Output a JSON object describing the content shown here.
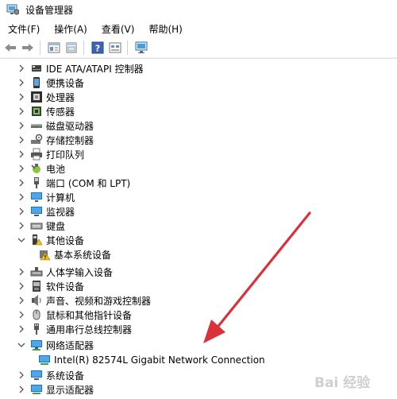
{
  "window": {
    "title": "设备管理器"
  },
  "menu": [
    {
      "label": "文件(F)"
    },
    {
      "label": "操作(A)"
    },
    {
      "label": "查看(V)"
    },
    {
      "label": "帮助(H)"
    }
  ],
  "toolbar": {
    "icons": [
      "back-arrow-icon",
      "forward-arrow-icon",
      "properties-icon",
      "update-driver-icon",
      "help-icon",
      "show-hidden-icon",
      "scan-hardware-icon"
    ]
  },
  "tree": {
    "items": [
      {
        "label": "IDE ATA/ATAPI 控制器",
        "icon": "ide-controller-icon",
        "expanded": false
      },
      {
        "label": "便携设备",
        "icon": "portable-device-icon",
        "expanded": false
      },
      {
        "label": "处理器",
        "icon": "processor-icon",
        "expanded": false
      },
      {
        "label": "传感器",
        "icon": "sensor-icon",
        "expanded": false
      },
      {
        "label": "磁盘驱动器",
        "icon": "disk-drive-icon",
        "expanded": false
      },
      {
        "label": "存储控制器",
        "icon": "storage-controller-icon",
        "expanded": false
      },
      {
        "label": "打印队列",
        "icon": "printer-icon",
        "expanded": false
      },
      {
        "label": "电池",
        "icon": "battery-icon",
        "expanded": false
      },
      {
        "label": "端口 (COM 和 LPT)",
        "icon": "port-icon",
        "expanded": false
      },
      {
        "label": "计算机",
        "icon": "computer-icon",
        "expanded": false
      },
      {
        "label": "监视器",
        "icon": "monitor-icon",
        "expanded": false
      },
      {
        "label": "键盘",
        "icon": "keyboard-icon",
        "expanded": false
      },
      {
        "label": "其他设备",
        "icon": "other-devices-icon",
        "expanded": true
      },
      {
        "label": "基本系统设备",
        "icon": "warning-device-icon",
        "child": true
      },
      {
        "label": "人体学输入设备",
        "icon": "hid-icon",
        "expanded": false
      },
      {
        "label": "软件设备",
        "icon": "software-device-icon",
        "expanded": false
      },
      {
        "label": "声音、视频和游戏控制器",
        "icon": "sound-icon",
        "expanded": false
      },
      {
        "label": "鼠标和其他指针设备",
        "icon": "mouse-icon",
        "expanded": false
      },
      {
        "label": "通用串行总线控制器",
        "icon": "usb-icon",
        "expanded": false
      },
      {
        "label": "网络适配器",
        "icon": "network-adapter-icon",
        "expanded": true
      },
      {
        "label": "Intel(R) 82574L Gigabit Network Connection",
        "icon": "network-card-icon",
        "child": true
      },
      {
        "label": "系统设备",
        "icon": "system-device-icon",
        "expanded": false
      },
      {
        "label": "显示适配器",
        "icon": "display-adapter-icon",
        "expanded": false
      }
    ]
  },
  "annotation": {
    "arrow_color": "#d9323a"
  },
  "watermark": {
    "text": "Bai 经验"
  }
}
